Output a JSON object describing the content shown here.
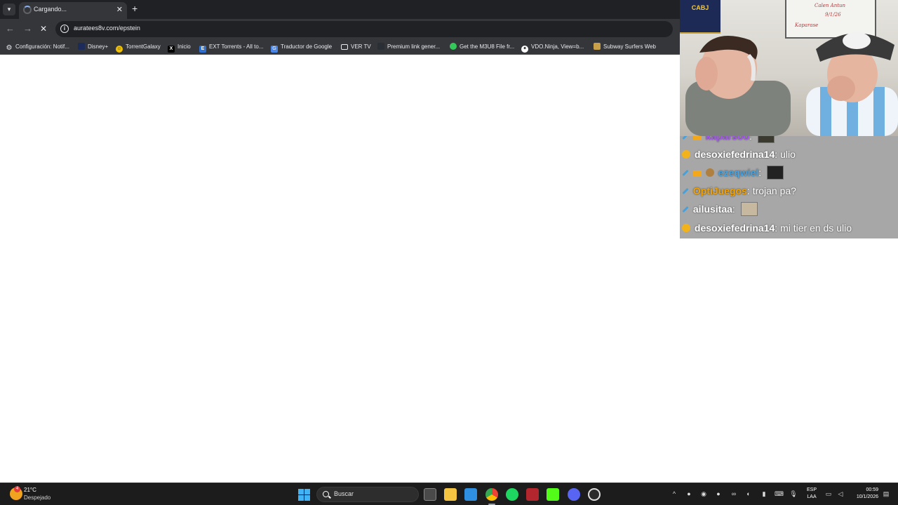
{
  "browser": {
    "tab": {
      "title": "Cargando..."
    },
    "address_bar": {
      "url": "auratees8v.com/epstein"
    },
    "bookmarks": [
      {
        "label": "Configuración: Notif...",
        "icon": "gear-icon"
      },
      {
        "label": "Disney+",
        "icon": "disney-icon"
      },
      {
        "label": "TorrentGalaxy",
        "icon": "smiley-icon"
      },
      {
        "label": "Inicio",
        "icon": "x-icon"
      },
      {
        "label": "EXT Torrents - All to...",
        "icon": "ext-icon"
      },
      {
        "label": "Traductor de Google",
        "icon": "translate-icon"
      },
      {
        "label": "VER TV",
        "icon": "folder-icon"
      },
      {
        "label": "Premium link gener...",
        "icon": "link-icon"
      },
      {
        "label": "Get the M3U8 File fr...",
        "icon": "green-dot-icon"
      },
      {
        "label": "VDO.Ninja, View=b...",
        "icon": "ninja-icon"
      },
      {
        "label": "Subway Surfers Web",
        "icon": "subway-icon"
      }
    ]
  },
  "stream_overlay": {
    "whiteboard_lines": [
      "Calen Antun",
      "9/1/26",
      "Kaparase"
    ],
    "poster_text": "CABJ",
    "chat": [
      {
        "user": "kaparsoo",
        "text": "",
        "user_color": "#a855f7",
        "emote": true
      },
      {
        "user": "desoxiefedrina14",
        "text": "ulio",
        "user_color": "#ffffff"
      },
      {
        "user": "ezeqwiel",
        "text": "",
        "user_color": "#4aa3df",
        "emote": true
      },
      {
        "user": "OptiJuegos",
        "text": "trojan pa?",
        "user_color": "#f5a300"
      },
      {
        "user": "ailusitaa",
        "text": "",
        "user_color": "#ffffff",
        "emote": true
      },
      {
        "user": "desoxiefedrina14",
        "text": "mi tier en ds ulio",
        "user_color": "#ffffff"
      }
    ]
  },
  "taskbar": {
    "weather": {
      "temp": "21°C",
      "condition": "Despejado",
      "badge": "4"
    },
    "search_placeholder": "Buscar",
    "language": {
      "line1": "ESP",
      "line2": "LAA"
    },
    "clock": {
      "time": "00:59",
      "date": "10/1/2026"
    },
    "apps": [
      "task-view-icon",
      "file-explorer-icon",
      "photos-icon",
      "chrome-icon",
      "spotify-icon",
      "winamp-icon",
      "kick-icon",
      "discord-icon",
      "obs-icon"
    ]
  }
}
